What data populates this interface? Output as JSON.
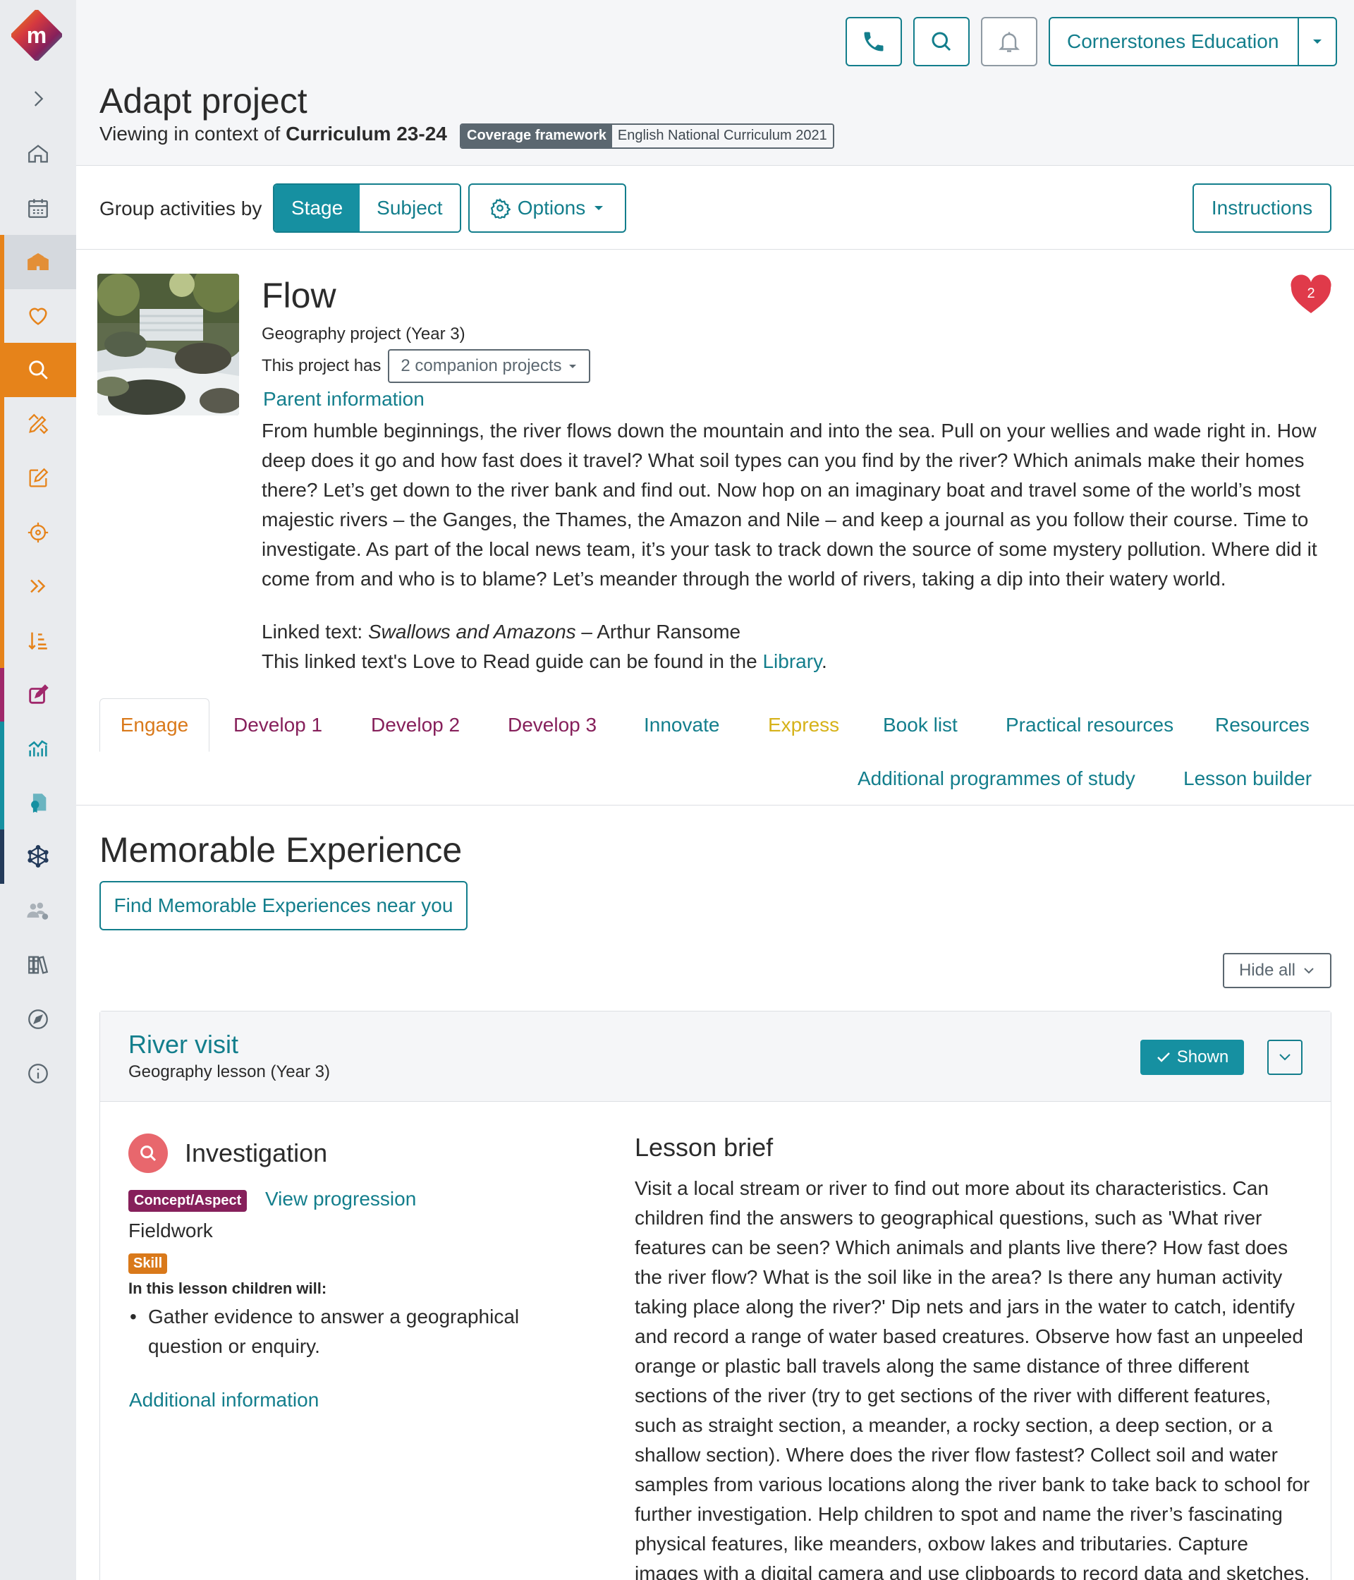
{
  "sidebar": {
    "items": [
      {
        "icon": "chevron-right-icon",
        "color": "#5b6770"
      },
      {
        "icon": "home-icon",
        "color": "#5b6770"
      },
      {
        "icon": "calendar-icon",
        "color": "#5b6770"
      },
      {
        "icon": "school-icon",
        "color": "#e6831a"
      },
      {
        "icon": "heart-icon",
        "color": "#e6831a"
      },
      {
        "icon": "search-icon",
        "color": "#ffffff"
      },
      {
        "icon": "pencil-ruler-icon",
        "color": "#e6831a"
      },
      {
        "icon": "edit-icon",
        "color": "#e6831a"
      },
      {
        "icon": "target-icon",
        "color": "#e6831a"
      },
      {
        "icon": "double-chevron-icon",
        "color": "#e6831a"
      },
      {
        "icon": "sort-icon",
        "color": "#e6831a"
      },
      {
        "icon": "edit-square-icon",
        "color": "#a0286b"
      },
      {
        "icon": "chart-icon",
        "color": "#1690a1"
      },
      {
        "icon": "certificate-icon",
        "color": "#1690a1"
      },
      {
        "icon": "network-icon",
        "color": "#233a5a"
      },
      {
        "icon": "users-cog-icon",
        "color": "#8f9aa3"
      },
      {
        "icon": "library-icon",
        "color": "#5b6770"
      },
      {
        "icon": "compass-icon",
        "color": "#5b6770"
      },
      {
        "icon": "info-icon",
        "color": "#5b6770"
      }
    ]
  },
  "header": {
    "organisation": "Cornerstones Education",
    "page_title": "Adapt project",
    "context_prefix": "Viewing in context of",
    "context_value": "Curriculum 23-24",
    "coverage_label": "Coverage framework",
    "coverage_value": "English National Curriculum 2021"
  },
  "groupbar": {
    "label": "Group activities by",
    "stage": "Stage",
    "subject": "Subject",
    "options": "Options",
    "instructions": "Instructions"
  },
  "project": {
    "title": "Flow",
    "subtitle": "Geography project (Year 3)",
    "companion_prefix": "This project has",
    "companion_value": "2 companion projects",
    "parent_info": "Parent information",
    "favourites": "2",
    "description": "From humble beginnings, the river flows down the mountain and into the sea. Pull on your wellies and wade right in. How deep does it go and how fast does it travel? What soil types can you find by the river? Which animals make their homes there? Let’s get down to the river bank and find out. Now hop on an imaginary boat and travel some of the world’s most majestic rivers – the Ganges, the Thames, the Amazon and Nile – and keep a journal as you follow their course. Time to investigate. As part of the local news team, it’s your task to track down the source of some mystery pollution. Where did it come from and who is to blame? Let’s meander through the world of rivers, taking a dip into their watery world.",
    "linked_prefix": "Linked text:",
    "linked_title": "Swallows and Amazons",
    "linked_author": "– Arthur Ransome",
    "guide_prefix": "This linked text's Love to Read guide can be found in the",
    "guide_link": "Library",
    "guide_suffix": "."
  },
  "tabs": [
    {
      "label": "Engage",
      "color": "#d9791a"
    },
    {
      "label": "Develop 1",
      "color": "#86205b"
    },
    {
      "label": "Develop 2",
      "color": "#86205b"
    },
    {
      "label": "Develop 3",
      "color": "#86205b"
    },
    {
      "label": "Innovate",
      "color": "#137e8c"
    },
    {
      "label": "Express",
      "color": "#d6b21a"
    },
    {
      "label": "Book list",
      "color": "#137e8c"
    },
    {
      "label": "Practical resources",
      "color": "#137e8c"
    },
    {
      "label": "Resources",
      "color": "#137e8c"
    },
    {
      "label": "Additional programmes of study",
      "color": "#137e8c"
    },
    {
      "label": "Lesson builder",
      "color": "#137e8c"
    }
  ],
  "section": {
    "title": "Memorable Experience",
    "find_button": "Find Memorable Experiences near you",
    "hide_all": "Hide all"
  },
  "lesson": {
    "title": "River visit",
    "subtitle": "Geography lesson (Year 3)",
    "shown": "Shown",
    "type": "Investigation",
    "concept_badge": "Concept/Aspect",
    "view_progression": "View progression",
    "concept": "Fieldwork",
    "skill_badge": "Skill",
    "children_will": "In this lesson children will:",
    "objectives": [
      "Gather evidence to answer a geographical question or enquiry."
    ],
    "additional_info": "Additional information",
    "brief_title": "Lesson brief",
    "brief": "Visit a local stream or river to find out more about its characteristics. Can children find the answers to geographical questions, such as 'What river features can be seen? Which animals and plants live there? How fast does the river flow? What is the soil like in the area? Is there any human activity taking place along the river?' Dip nets and jars in the water to catch, identify and record a range of water based creatures. Observe how fast an unpeeled orange or plastic ball travels along the same distance of three different sections of the river (try to get sections of the river with different features, such as straight section, a meander, a rocky section, a deep section, or a shallow section). Where does the river flow fastest? Collect soil and water samples from various locations along the river bank to take back to school for further investigation. Help children to spot and name the river’s fascinating physical features, like meanders, oxbow lakes and tributaries. Capture images with a digital camera and use clipboards to record data and sketches."
  },
  "colors": {
    "teal": "#137e8c",
    "teal_fill": "#1690a1",
    "orange": "#e6831a",
    "plum": "#86205b",
    "heart": "#e03a4a"
  }
}
